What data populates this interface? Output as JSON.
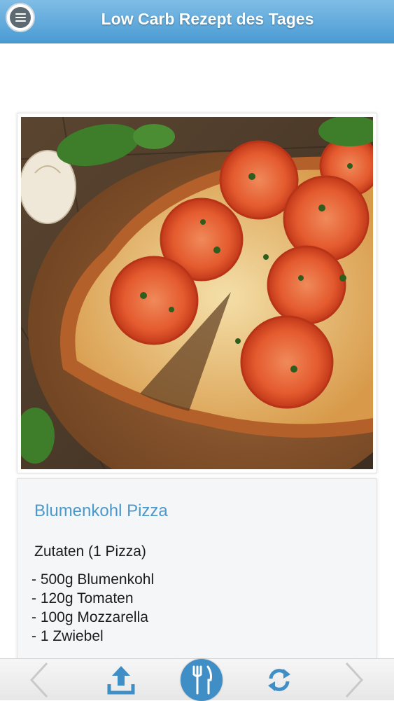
{
  "header": {
    "title": "Low Carb Rezept des Tages"
  },
  "recipe": {
    "title": "Blumenkohl Pizza",
    "ingredients_heading": "Zutaten (1 Pizza)",
    "ingredients": [
      "- 500g Blumenkohl",
      "- 120g Tomaten",
      "- 100g Mozzarella",
      "- 1 Zwiebel"
    ]
  },
  "icons": {
    "menu": "menu-icon",
    "prev": "chevron-left-icon",
    "upload": "share-upload-icon",
    "food": "fork-knife-icon",
    "refresh": "refresh-icon",
    "next": "chevron-right-icon"
  },
  "colors": {
    "header_top": "#7fbde6",
    "header_bottom": "#4a9bd3",
    "recipe_title": "#4a98cc",
    "accent": "#3f8fc6",
    "footer": "#eeeeee"
  }
}
